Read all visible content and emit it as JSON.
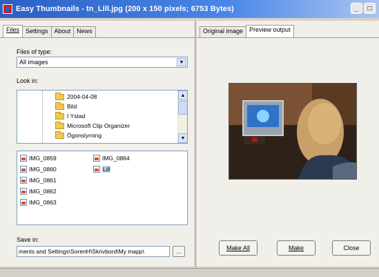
{
  "window": {
    "title": "Easy Thumbnails - tn_Lill.jpg  (200 x 150 pixels;  6753 Bytes)",
    "minimize_glyph": "_",
    "maximize_glyph": "□"
  },
  "left_tabs": [
    "Files",
    "Settings",
    "About",
    "News"
  ],
  "right_tabs": [
    "Original image",
    "Preview output"
  ],
  "files_of_type": {
    "label": "Files of type:",
    "value": "All images"
  },
  "look_in": {
    "label": "Look in:",
    "folders": [
      "2004-04-08",
      "Bild",
      "I Ystad",
      "Microsoft Clip Organizer",
      "Ögonslyrning"
    ]
  },
  "file_list": {
    "column1": [
      "IMG_0859",
      "IMG_0860",
      "IMG_0861",
      "IMG_0862",
      "IMG_0863"
    ],
    "column2": [
      "IMG_0864",
      "Lill"
    ],
    "selected": "Lill"
  },
  "save_in": {
    "label": "Save in:",
    "path": "ments and Settings\\SorenH\\Skrivbord\\My mapp\\",
    "browse_label": "..."
  },
  "buttons": {
    "make_all": "Make All",
    "make": "Make",
    "close": "Close"
  },
  "icons": {
    "app": "app-icon",
    "folder": "folder-icon",
    "image_file": "image-file-icon",
    "scroll_up": "scroll-up-arrow-icon",
    "scroll_down": "scroll-down-arrow-icon",
    "dropdown": "dropdown-arrow-icon"
  }
}
